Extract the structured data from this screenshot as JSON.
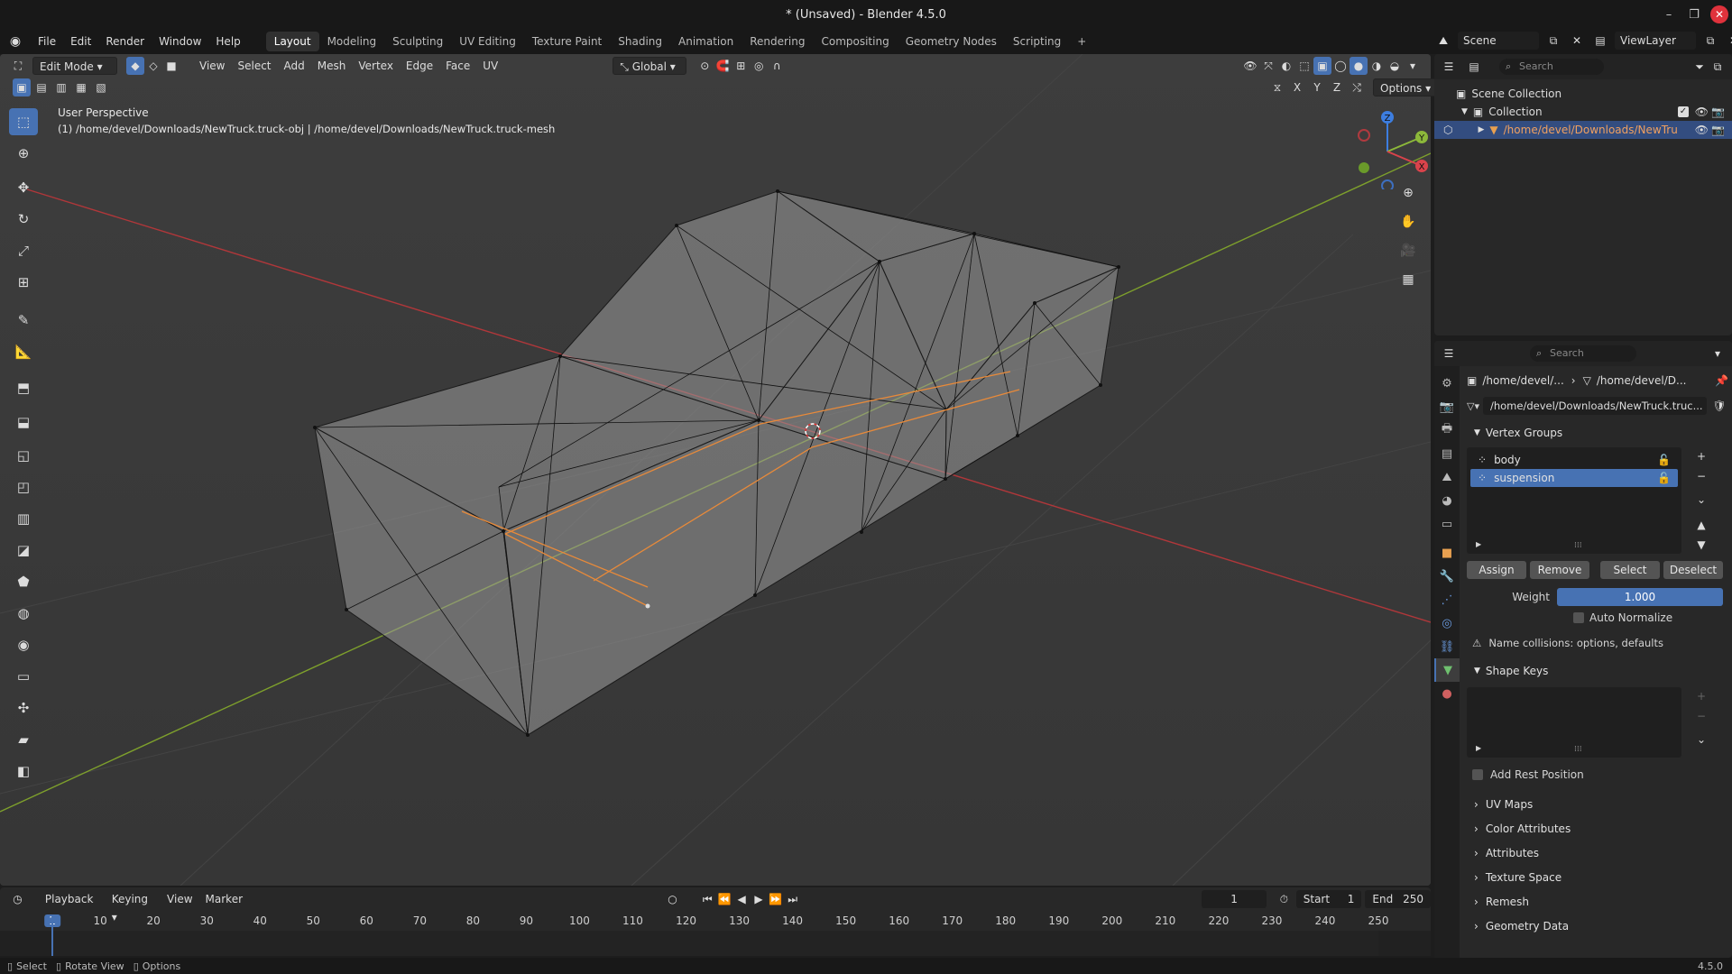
{
  "window": {
    "title": "* (Unsaved) - Blender 4.5.0",
    "minimize": "–",
    "maximize": "❐",
    "close": "✕"
  },
  "menus": [
    "File",
    "Edit",
    "Render",
    "Window",
    "Help"
  ],
  "workspaces": [
    "Layout",
    "Modeling",
    "Sculpting",
    "UV Editing",
    "Texture Paint",
    "Shading",
    "Animation",
    "Rendering",
    "Compositing",
    "Geometry Nodes",
    "Scripting"
  ],
  "active_workspace": "Layout",
  "scene": {
    "name": "Scene",
    "view_layer": "ViewLayer"
  },
  "viewport": {
    "mode": "Edit Mode",
    "menus": [
      "View",
      "Select",
      "Add",
      "Mesh",
      "Vertex",
      "Edge",
      "Face",
      "UV"
    ],
    "orientation": "Global",
    "options_label": "Options",
    "axis_labels": [
      "X",
      "Y",
      "Z"
    ],
    "perspective": "User Perspective",
    "object_info": "(1) /home/devel/Downloads/NewTruck.truck-obj | /home/devel/Downloads/NewTruck.truck-mesh",
    "gizmo": {
      "x": "X",
      "y": "Y",
      "z": "Z"
    }
  },
  "outliner": {
    "search_placeholder": "Search",
    "scene_collection": "Scene Collection",
    "collection": "Collection",
    "object": "/home/devel/Downloads/NewTru"
  },
  "properties": {
    "search_placeholder": "Search",
    "breadcrumb_1": "/home/devel/...",
    "breadcrumb_2": "/home/devel/D...",
    "mesh_name": "/home/devel/Downloads/NewTruck.truc...",
    "vertex_groups_title": "Vertex Groups",
    "vertex_groups": [
      {
        "name": "body",
        "selected": false
      },
      {
        "name": "suspension",
        "selected": true
      }
    ],
    "buttons": {
      "assign": "Assign",
      "remove": "Remove",
      "select": "Select",
      "deselect": "Deselect"
    },
    "weight_label": "Weight",
    "weight_value": "1.000",
    "auto_normalize": "Auto Normalize",
    "warning": "Name collisions: options, defaults",
    "shape_keys_title": "Shape Keys",
    "add_rest_position": "Add Rest Position",
    "collapsed_panels": [
      "UV Maps",
      "Color Attributes",
      "Attributes",
      "Texture Space",
      "Remesh",
      "Geometry Data"
    ]
  },
  "timeline": {
    "menus": [
      "Playback",
      "Keying",
      "View",
      "Marker"
    ],
    "current_frame": "1",
    "start_label": "Start",
    "start_value": "1",
    "end_label": "End",
    "end_value": "250",
    "ticks": [
      "1",
      "10",
      "20",
      "30",
      "40",
      "50",
      "60",
      "70",
      "80",
      "90",
      "100",
      "110",
      "120",
      "130",
      "140",
      "150",
      "160",
      "170",
      "180",
      "190",
      "200",
      "210",
      "220",
      "230",
      "240",
      "250"
    ]
  },
  "statusbar": {
    "select": "Select",
    "rotate": "Rotate View",
    "options": "Options",
    "version": "4.5.0"
  },
  "colors": {
    "accent": "#4772b3",
    "x_axis": "#c0393b",
    "y_axis": "#7fa32e",
    "selected_edge": "#e88a3a"
  }
}
